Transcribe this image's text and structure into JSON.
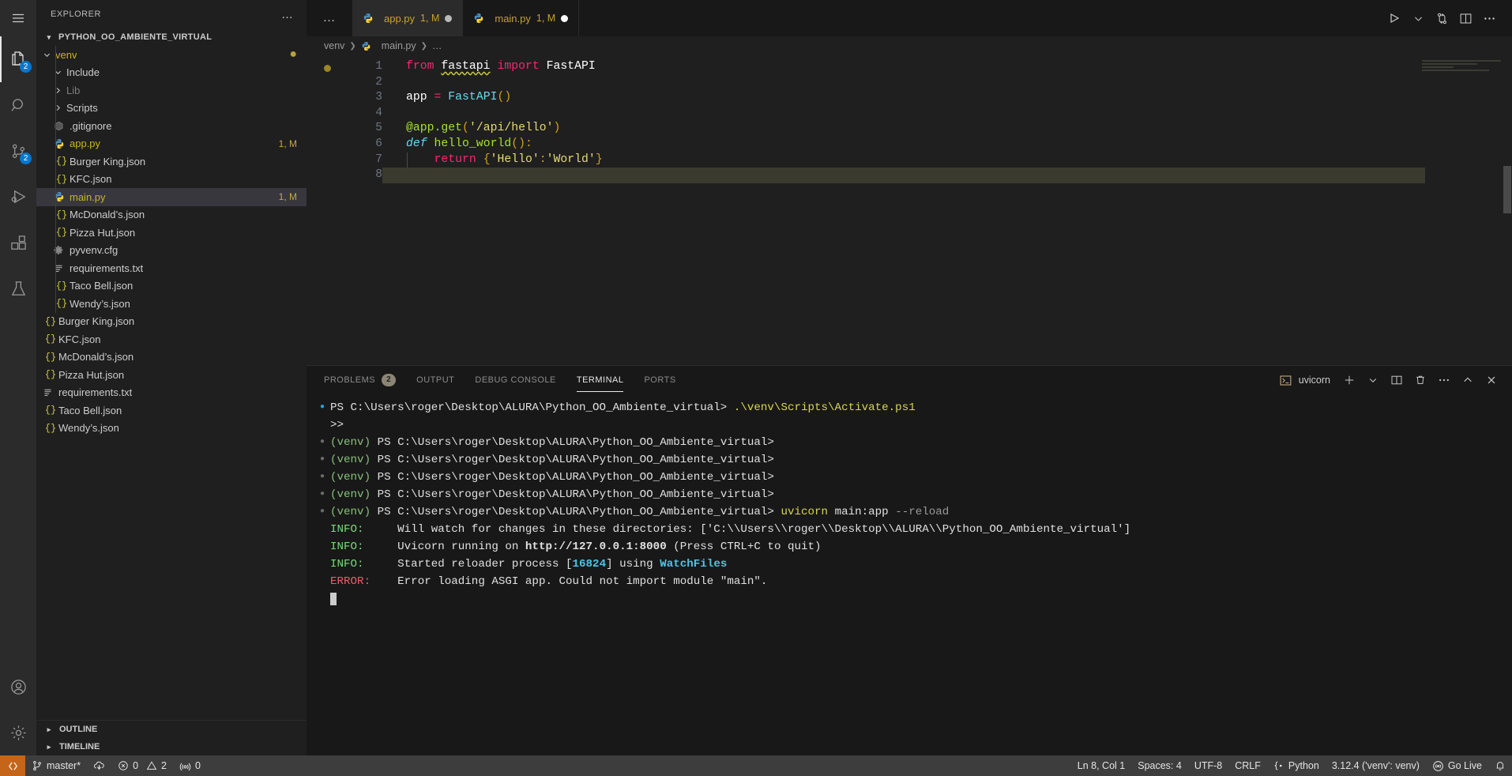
{
  "activitybar": {
    "items": [
      {
        "name": "menu",
        "icon": "hamburger-icon",
        "badge": ""
      },
      {
        "name": "explorer",
        "icon": "files-icon",
        "badge": "2"
      },
      {
        "name": "search",
        "icon": "search-icon",
        "badge": ""
      },
      {
        "name": "source-control",
        "icon": "source-control-icon",
        "badge": "2"
      },
      {
        "name": "run-debug",
        "icon": "run-debug-icon",
        "badge": ""
      },
      {
        "name": "extensions",
        "icon": "extensions-icon",
        "badge": ""
      },
      {
        "name": "testing",
        "icon": "beaker-icon",
        "badge": ""
      }
    ],
    "bottom": [
      {
        "name": "accounts",
        "icon": "account-icon"
      },
      {
        "name": "settings",
        "icon": "gear-icon"
      }
    ]
  },
  "sidebar": {
    "title": "EXPLORER",
    "more_label": "…",
    "root": "PYTHON_OO_AMBIENTE_VIRTUAL",
    "tree": [
      {
        "label": "venv",
        "type": "folder-open",
        "indent": 1,
        "color": "yellow",
        "dirty": true
      },
      {
        "label": "Include",
        "type": "folder-open",
        "indent": 2
      },
      {
        "label": "Lib",
        "type": "folder",
        "indent": 2,
        "color": "dim"
      },
      {
        "label": "Scripts",
        "type": "folder",
        "indent": 2
      },
      {
        "label": ".gitignore",
        "type": "git",
        "indent": 2
      },
      {
        "label": "app.py",
        "type": "py",
        "indent": 2,
        "color": "yellow",
        "meta": "1, M"
      },
      {
        "label": "Burger King.json",
        "type": "json",
        "indent": 2
      },
      {
        "label": "KFC.json",
        "type": "json",
        "indent": 2
      },
      {
        "label": "main.py",
        "type": "py",
        "indent": 2,
        "color": "yellow",
        "meta": "1, M",
        "selected": true
      },
      {
        "label": "McDonald’s.json",
        "type": "json",
        "indent": 2
      },
      {
        "label": "Pizza Hut.json",
        "type": "json",
        "indent": 2
      },
      {
        "label": "pyvenv.cfg",
        "type": "cfg",
        "indent": 2
      },
      {
        "label": "requirements.txt",
        "type": "txt",
        "indent": 2
      },
      {
        "label": "Taco Bell.json",
        "type": "json",
        "indent": 2
      },
      {
        "label": "Wendy’s.json",
        "type": "json",
        "indent": 2
      },
      {
        "label": "Burger King.json",
        "type": "json",
        "indent": 1
      },
      {
        "label": "KFC.json",
        "type": "json",
        "indent": 1
      },
      {
        "label": "McDonald’s.json",
        "type": "json",
        "indent": 1
      },
      {
        "label": "Pizza Hut.json",
        "type": "json",
        "indent": 1
      },
      {
        "label": "requirements.txt",
        "type": "txt",
        "indent": 1
      },
      {
        "label": "Taco Bell.json",
        "type": "json",
        "indent": 1
      },
      {
        "label": "Wendy’s.json",
        "type": "json",
        "indent": 1
      }
    ],
    "outline_label": "OUTLINE",
    "timeline_label": "TIMELINE"
  },
  "tabs": {
    "overflow_label": "…",
    "items": [
      {
        "name": "app.py",
        "meta": "1, M",
        "active": true,
        "dirty": true,
        "dirty_color": "grey"
      },
      {
        "name": "main.py",
        "meta": "1, M",
        "active": false,
        "dirty": true,
        "dirty_color": "white"
      }
    ],
    "actions": [
      "run-icon",
      "chevron-down-icon",
      "split-editor-source-control-icon",
      "split-editor-icon",
      "more-actions-icon"
    ]
  },
  "breadcrumb": {
    "parts": [
      "venv",
      "main.py",
      "…"
    ]
  },
  "editor": {
    "lines": [
      {
        "no": "1",
        "tokens": [
          {
            "t": "from ",
            "c": "k-import"
          },
          {
            "t": "fastapi",
            "c": "k-mod squiggle"
          },
          {
            "t": " import ",
            "c": "k-import"
          },
          {
            "t": "FastAPI",
            "c": "k-var"
          }
        ]
      },
      {
        "no": "2",
        "tokens": []
      },
      {
        "no": "3",
        "tokens": [
          {
            "t": "app ",
            "c": "k-var"
          },
          {
            "t": "= ",
            "c": "k-op"
          },
          {
            "t": "FastAPI",
            "c": "k-cls"
          },
          {
            "t": "()",
            "c": "k-paren"
          }
        ]
      },
      {
        "no": "4",
        "tokens": []
      },
      {
        "no": "5",
        "tokens": [
          {
            "t": "@app.get",
            "c": "k-deco"
          },
          {
            "t": "(",
            "c": "k-paren"
          },
          {
            "t": "'/api/hello'",
            "c": "k-str"
          },
          {
            "t": ")",
            "c": "k-paren"
          }
        ]
      },
      {
        "no": "6",
        "tokens": [
          {
            "t": "def ",
            "c": "k-def"
          },
          {
            "t": "hello_world",
            "c": "k-func"
          },
          {
            "t": "()",
            "c": "k-paren"
          },
          {
            "t": ":",
            "c": "k-paren"
          }
        ]
      },
      {
        "no": "7",
        "indent": true,
        "tokens": [
          {
            "t": "    ",
            "c": ""
          },
          {
            "t": "return ",
            "c": "k-op"
          },
          {
            "t": "{",
            "c": "k-brace"
          },
          {
            "t": "'Hello'",
            "c": "k-str"
          },
          {
            "t": ":",
            "c": "k-brace"
          },
          {
            "t": "'World'",
            "c": "k-str"
          },
          {
            "t": "}",
            "c": "k-brace"
          }
        ]
      },
      {
        "no": "8",
        "current": true,
        "tokens": []
      }
    ]
  },
  "panel": {
    "tabs": [
      {
        "label": "PROBLEMS",
        "badge": "2",
        "active": false
      },
      {
        "label": "OUTPUT",
        "badge": "",
        "active": false
      },
      {
        "label": "DEBUG CONSOLE",
        "badge": "",
        "active": false
      },
      {
        "label": "TERMINAL",
        "badge": "",
        "active": true
      },
      {
        "label": "PORTS",
        "badge": "",
        "active": false
      }
    ],
    "shell_label": "uvicorn",
    "actions": [
      "new-terminal-icon",
      "chevron-down-icon",
      "split-terminal-icon",
      "kill-terminal-icon",
      "more-actions-icon",
      "chevron-up-icon",
      "close-panel-icon"
    ],
    "terminal_lines": [
      {
        "mark": "blue",
        "parts": [
          {
            "t": "PS C:\\Users\\roger\\Desktop\\ALURA\\Python_OO_Ambiente_virtual> ",
            "c": "t-white"
          },
          {
            "t": ".\\venv\\Scripts\\Activate.ps1",
            "c": "t-cmd"
          }
        ]
      },
      {
        "mark": "",
        "parts": [
          {
            "t": ">>",
            "c": "t-white"
          }
        ]
      },
      {
        "mark": "grey",
        "parts": [
          {
            "t": "(venv) ",
            "c": "t-venv"
          },
          {
            "t": "PS C:\\Users\\roger\\Desktop\\ALURA\\Python_OO_Ambiente_virtual>",
            "c": "t-white"
          }
        ]
      },
      {
        "mark": "grey",
        "parts": [
          {
            "t": "(venv) ",
            "c": "t-venv"
          },
          {
            "t": "PS C:\\Users\\roger\\Desktop\\ALURA\\Python_OO_Ambiente_virtual>",
            "c": "t-white"
          }
        ]
      },
      {
        "mark": "grey",
        "parts": [
          {
            "t": "(venv) ",
            "c": "t-venv"
          },
          {
            "t": "PS C:\\Users\\roger\\Desktop\\ALURA\\Python_OO_Ambiente_virtual>",
            "c": "t-white"
          }
        ]
      },
      {
        "mark": "grey",
        "parts": [
          {
            "t": "(venv) ",
            "c": "t-venv"
          },
          {
            "t": "PS C:\\Users\\roger\\Desktop\\ALURA\\Python_OO_Ambiente_virtual>",
            "c": "t-white"
          }
        ]
      },
      {
        "mark": "grey",
        "parts": [
          {
            "t": "(venv) ",
            "c": "t-venv"
          },
          {
            "t": "PS C:\\Users\\roger\\Desktop\\ALURA\\Python_OO_Ambiente_virtual> ",
            "c": "t-white"
          },
          {
            "t": "uvicorn",
            "c": "t-cmd"
          },
          {
            "t": " main:app ",
            "c": "t-white"
          },
          {
            "t": "--reload",
            "c": "t-dim"
          }
        ]
      },
      {
        "mark": "",
        "parts": [
          {
            "t": "INFO:",
            "c": "t-info"
          },
          {
            "t": "     Will watch for changes in these directories: ['C:\\\\Users\\\\roger\\\\Desktop\\\\ALURA\\\\Python_OO_Ambiente_virtual']",
            "c": "t-white"
          }
        ]
      },
      {
        "mark": "",
        "parts": [
          {
            "t": "INFO:",
            "c": "t-info"
          },
          {
            "t": "     Uvicorn running on ",
            "c": "t-white"
          },
          {
            "t": "http://127.0.0.1:8000",
            "c": "t-bold"
          },
          {
            "t": " (Press CTRL+C to quit)",
            "c": "t-white"
          }
        ]
      },
      {
        "mark": "",
        "parts": [
          {
            "t": "INFO:",
            "c": "t-info"
          },
          {
            "t": "     Started reloader process [",
            "c": "t-white"
          },
          {
            "t": "16824",
            "c": "t-num"
          },
          {
            "t": "] using ",
            "c": "t-white"
          },
          {
            "t": "WatchFiles",
            "c": "t-cyan"
          }
        ]
      },
      {
        "mark": "",
        "parts": [
          {
            "t": "ERROR:",
            "c": "t-error"
          },
          {
            "t": "    Error loading ASGI app. Could not import module \"main\".",
            "c": "t-white"
          }
        ]
      }
    ]
  },
  "statusbar": {
    "remote_icon": "remote-window-icon",
    "left": [
      {
        "icon": "source-control-branch-icon",
        "label": "master*"
      },
      {
        "icon": "sync-icon",
        "label": ""
      },
      {
        "icon": "error-icon",
        "label": "0"
      },
      {
        "icon": "warning-icon",
        "label": "2"
      },
      {
        "icon": "ports-icon",
        "label": "0"
      }
    ],
    "right": [
      {
        "icon": "",
        "label": "Ln 8, Col 1"
      },
      {
        "icon": "",
        "label": "Spaces: 4"
      },
      {
        "icon": "",
        "label": "UTF-8"
      },
      {
        "icon": "",
        "label": "CRLF"
      },
      {
        "icon": "python-icon",
        "label": "Python"
      },
      {
        "icon": "",
        "label": "3.12.4 ('venv': venv)"
      },
      {
        "icon": "broadcast-icon",
        "label": "Go Live"
      },
      {
        "icon": "bell-icon",
        "label": ""
      }
    ]
  },
  "colors": {
    "accent": "#0078d4",
    "remote": "#c5651a",
    "statusbar_bg": "#3d3d3d",
    "editor_bg": "#1f1f1f",
    "panel_bg": "#181818"
  }
}
